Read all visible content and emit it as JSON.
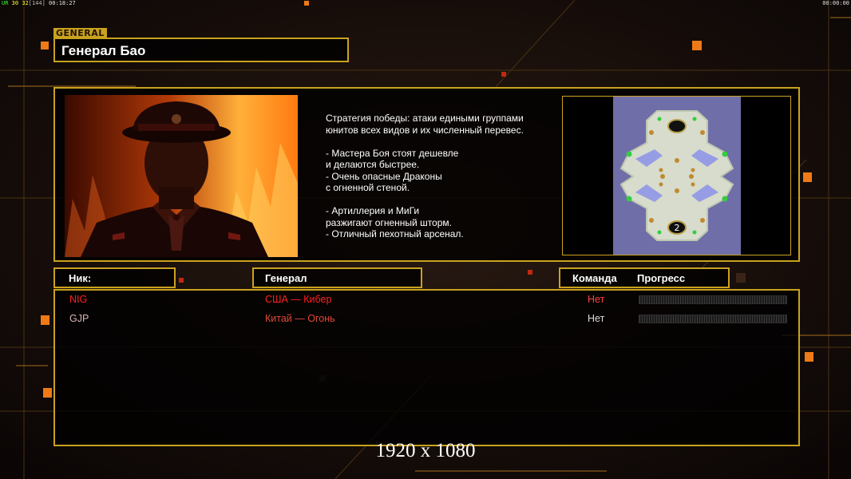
{
  "hud": {
    "fps_label": "UR",
    "fps_a": "30",
    "fps_b": "32",
    "fps_c": "[144]",
    "clock_left": "00:18:27",
    "clock_right": "00:00:00"
  },
  "general": {
    "tag": "GENERAL",
    "name": "Генерал Бао",
    "description": "Стратегия победы: атаки едиными группами\nюнитов всех видов и их численный перевес.\n\n- Мастера Боя стоят дешевле\nи делаются быстрее.\n- Очень опасные Драконы\nс огненной стеной.\n\n- Артиллерия и МиГи\nразжигают огненный шторм.\n- Отличный пехотный арсенал."
  },
  "map": {
    "player_marker": "2"
  },
  "table": {
    "headers": {
      "nick": "Ник:",
      "general": "Генерал",
      "team": "Команда",
      "progress": "Прогресс"
    },
    "rows": [
      {
        "nick": "NIG",
        "general": "США — Кибер",
        "team": "Нет"
      },
      {
        "nick": "GJP",
        "general": "Китай — Огонь",
        "team": "Нет"
      }
    ]
  },
  "overlay": {
    "resolution": "1920 x 1080"
  },
  "colors": {
    "accent": "#c9a21f",
    "player1": "#ff2020",
    "player2_general": "#e04a3a"
  }
}
